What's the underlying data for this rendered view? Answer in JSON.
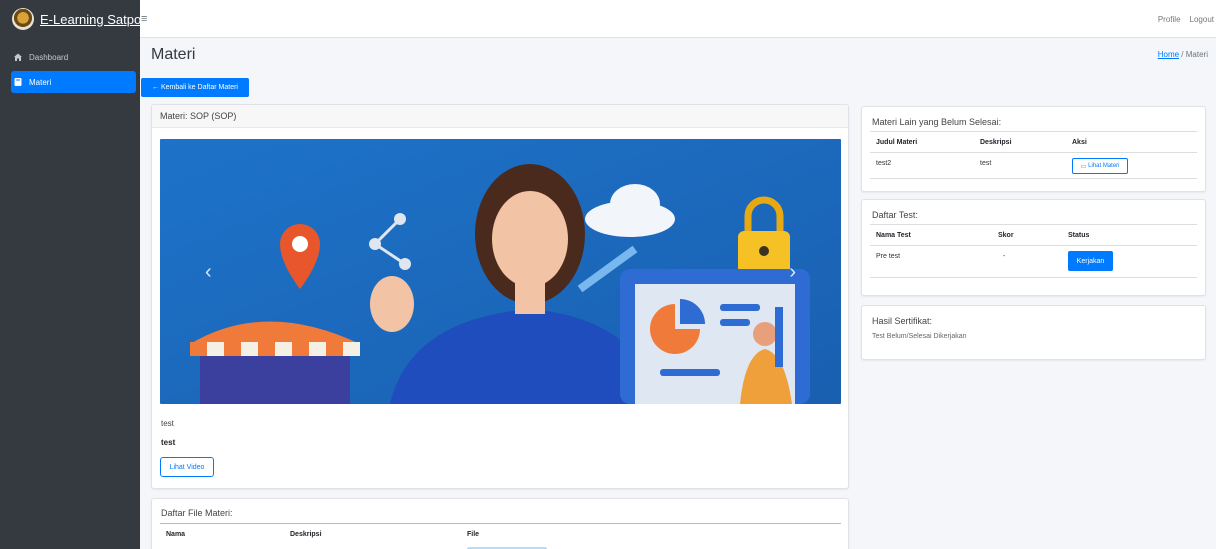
{
  "app": {
    "brand": "E-Learning Satpol PP",
    "hamburger": "≡"
  },
  "topnav": {
    "profile": "Profile",
    "logout": "Logout"
  },
  "sidebar": {
    "items": [
      {
        "label": "Dashboard",
        "icon": "home-icon",
        "active": false
      },
      {
        "label": "Materi",
        "icon": "book-icon",
        "active": true
      }
    ]
  },
  "header": {
    "title": "Materi",
    "breadcrumb_home": "Home",
    "breadcrumb_sep": "/",
    "breadcrumb_current": "Materi"
  },
  "back_button": "← Kembali ke Daftar Materi",
  "materi": {
    "title": "Materi: SOP (SOP)",
    "carousel_prev": "‹",
    "carousel_next": "›",
    "description": "test",
    "content": "test",
    "video_button": "Lihat Video"
  },
  "files": {
    "title": "Daftar File Materi:",
    "columns": [
      "Nama",
      "Deskripsi",
      "File"
    ]
  },
  "other_materi": {
    "title": "Materi Lain yang Belum Selesai:",
    "columns": [
      "Judul Materi",
      "Deskripsi",
      "Aksi"
    ],
    "rows": [
      {
        "judul": "test2",
        "deskripsi": "test",
        "aksi": "Lihat Materi"
      }
    ]
  },
  "tests": {
    "title": "Daftar Test:",
    "columns": [
      "Nama Test",
      "Skor",
      "Status"
    ],
    "rows": [
      {
        "nama": "Pre test",
        "skor": "-",
        "status": "Kerjakan"
      }
    ]
  },
  "certificate": {
    "title": "Hasil Sertifikat:",
    "text": "Test Belum/Selesai Dikerjakan"
  },
  "colors": {
    "primary": "#007bff",
    "sidebar": "#343a40",
    "background": "#f4f6f9"
  }
}
